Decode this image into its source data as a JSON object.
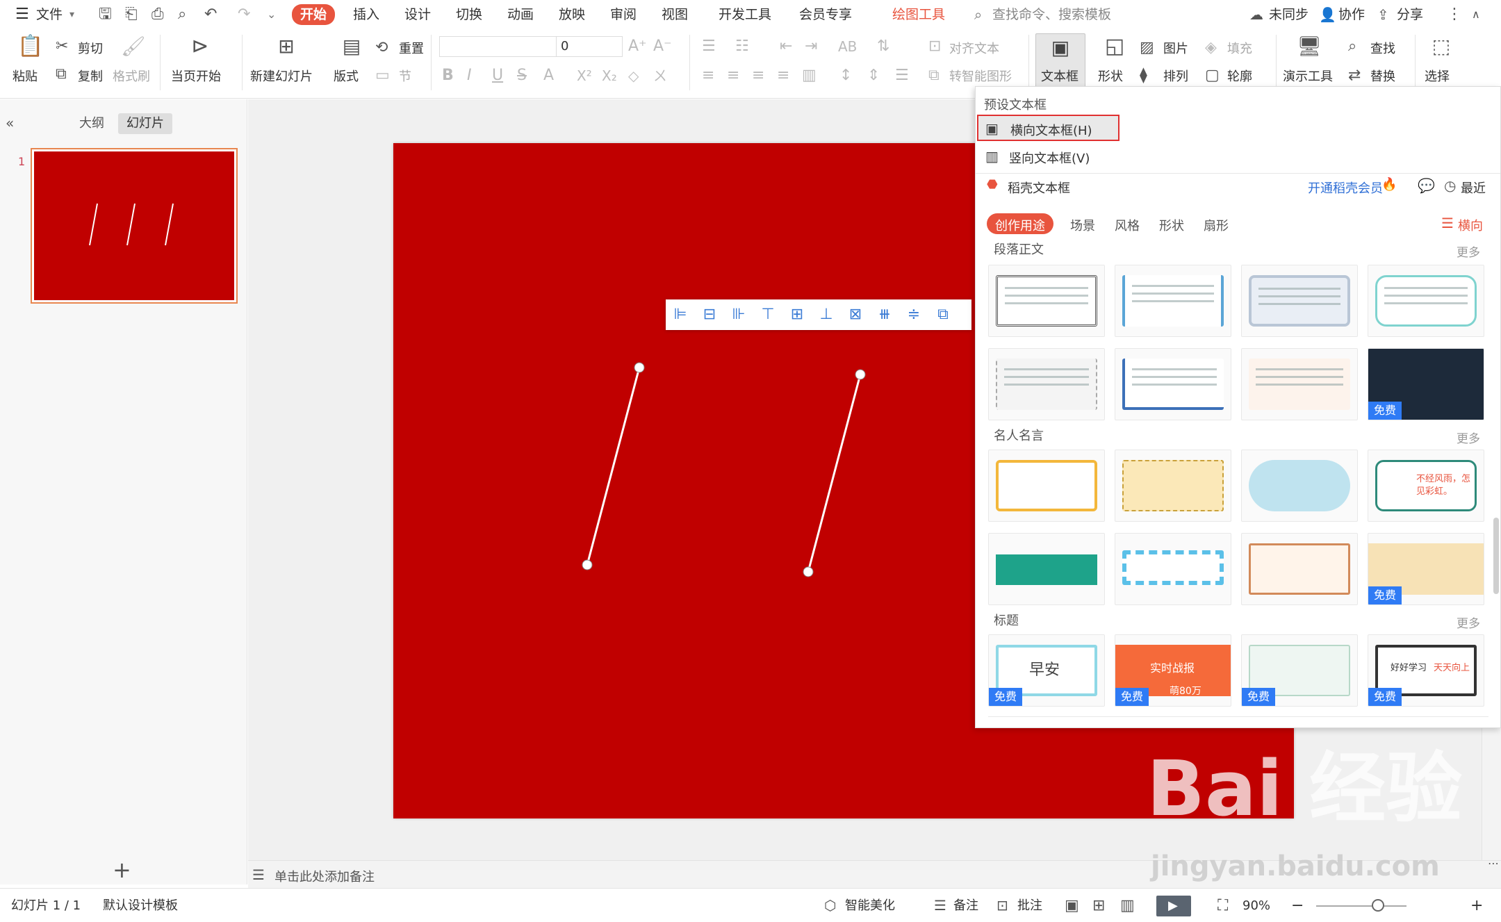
{
  "menubar": {
    "file": "文件",
    "tabs": [
      "开始",
      "插入",
      "设计",
      "切换",
      "动画",
      "放映",
      "审阅",
      "视图",
      "开发工具",
      "会员专享"
    ],
    "active_tab": "开始",
    "drawing_tools": "绘图工具",
    "search_placeholder": "查找命令、搜索模板",
    "sync": "未同步",
    "collab": "协作",
    "share": "分享"
  },
  "ribbon": {
    "paste": "粘贴",
    "cut": "剪切",
    "copy": "复制",
    "format_painter": "格式刷",
    "from_current": "当页开始",
    "new_slide": "新建幻灯片",
    "layout": "版式",
    "reset": "重置",
    "section": "节",
    "font_size": "0",
    "align_text": "对齐文本",
    "convert_smartart": "转智能图形",
    "textbox": "文本框",
    "shape": "形状",
    "picture": "图片",
    "fill": "填充",
    "arrange": "排列",
    "outline": "轮廓",
    "presenter_tools": "演示工具",
    "find": "查找",
    "replace": "替换",
    "select": "选择"
  },
  "sidebar": {
    "tab_outline": "大纲",
    "tab_slides": "幻灯片",
    "slide_number": "1"
  },
  "textbox_menu": {
    "preset_header": "预设文本框",
    "horizontal": "横向文本框(H)",
    "vertical": "竖向文本框(V)",
    "docer": "稻壳文本框",
    "open_member": "开通稻壳会员",
    "recent": "最近",
    "filters": [
      "创作用途",
      "场景",
      "风格",
      "形状",
      "扇形"
    ],
    "orientation": "横向",
    "more": "更多",
    "free": "免费",
    "sections": [
      {
        "title": "段落正文"
      },
      {
        "title": "名人名言"
      },
      {
        "title": "标题"
      }
    ],
    "card_texts": [
      "早安",
      "实时战报",
      "萌80万",
      "好好学习",
      "天天向上",
      "不经风雨，怎见彩虹。"
    ]
  },
  "notes": {
    "placeholder": "单击此处添加备注"
  },
  "status": {
    "slide_info": "幻灯片 1 / 1",
    "template": "默认设计模板",
    "smart_beautify": "智能美化",
    "notes": "备注",
    "comments": "批注",
    "zoom": "90%"
  },
  "watermark": {
    "brand": "Bai 经验",
    "url": "jingyan.baidu.com"
  },
  "colors": {
    "accent": "#e8543e",
    "slide_bg": "#c00000",
    "free_badge": "#2f7bf5",
    "highlight_border": "#e03030"
  }
}
